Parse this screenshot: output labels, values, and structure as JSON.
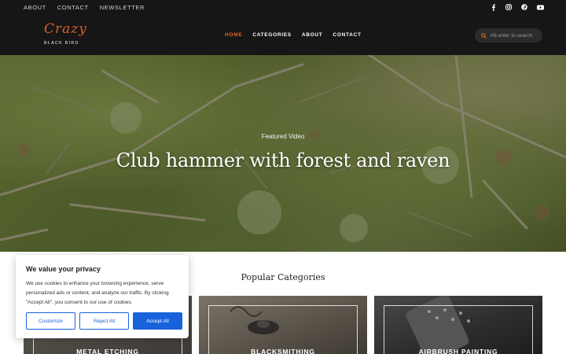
{
  "topbar": {
    "links": [
      "ABOUT",
      "CONTACT",
      "NEWSLETTER"
    ],
    "social_icons": [
      "facebook-icon",
      "instagram-icon",
      "pinterest-icon",
      "youtube-icon"
    ]
  },
  "header": {
    "logo_script": "Crazy",
    "logo_sub": "BLACK BIRD",
    "nav": [
      "HOME",
      "CATEGORIES",
      "ABOUT",
      "CONTACT"
    ],
    "active_nav": "HOME",
    "search_placeholder": "Hit enter to search"
  },
  "hero": {
    "kicker": "Featured Video",
    "title": "Club hammer with forest and raven"
  },
  "categories": {
    "title": "Popular Categories",
    "items": [
      "METAL ETCHING",
      "BLACKSMITHING",
      "AIRBRUSH PAINTING"
    ]
  },
  "cookie": {
    "title": "We value your privacy",
    "text": "We use cookies to enhance your browsing experience, serve personalized ads or content, and analyze our traffic. By clicking \"Accept All\", you consent to our use of cookies.",
    "customize": "Customize",
    "reject": "Reject All",
    "accept": "Accept All"
  },
  "colors": {
    "accent": "#e2692e",
    "header_bg": "#161616",
    "cookie_button": "#1863dc"
  }
}
